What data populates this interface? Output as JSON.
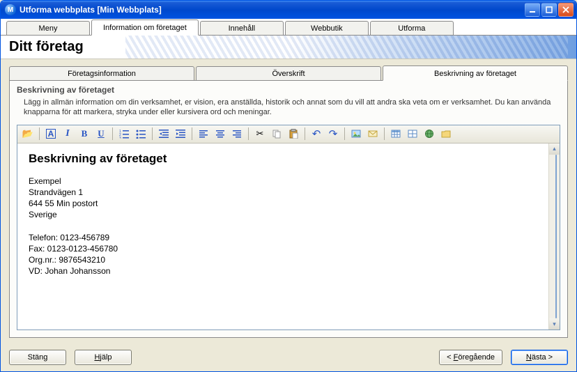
{
  "window": {
    "title": "Utforma webbplats [Min Webbplats]"
  },
  "main_tabs": {
    "items": [
      {
        "label": "Meny"
      },
      {
        "label": "Information om företaget"
      },
      {
        "label": "Innehåll"
      },
      {
        "label": "Webbutik"
      },
      {
        "label": "Utforma"
      }
    ],
    "active_index": 1
  },
  "page_header": "Ditt företag",
  "sub_tabs": {
    "items": [
      {
        "label": "Företagsinformation"
      },
      {
        "label": "Överskrift"
      },
      {
        "label": "Beskrivning av företaget"
      }
    ],
    "active_index": 2
  },
  "panel": {
    "title": "Beskrivning av företaget",
    "description": "Lägg in allmän information om din verksamhet, er vision, era anställda, historik och annat som du vill att andra ska veta om er verksamhet. Du kan använda knapparna för att markera, stryka under eller kursivera ord och meningar."
  },
  "editor": {
    "heading": "Beskrivning av företaget",
    "lines": [
      "Exempel",
      "Strandvägen 1",
      "644 55 Min postort",
      "Sverige",
      "",
      "Telefon: 0123-456789",
      "Fax: 0123-0123-456780",
      "Org.nr.: 9876543210",
      "VD: Johan Johansson"
    ]
  },
  "toolbar_buttons": {
    "open": "📂",
    "font": "A",
    "italic": "I",
    "bold": "B",
    "underline": "U",
    "listnum": "ol-icon",
    "listbul": "ul-icon",
    "outdent": "outdent-icon",
    "indent": "indent-icon",
    "alignl": "align-left-icon",
    "alignc": "align-center-icon",
    "alignr": "align-right-icon",
    "cut": "✂",
    "copy": "copy-icon",
    "paste": "paste-icon",
    "undo": "↶",
    "redo": "↷",
    "image": "image-icon",
    "mail": "mail-icon",
    "table": "table-icon",
    "props": "props-icon",
    "world": "world-icon",
    "meta": "meta-icon"
  },
  "footer": {
    "close": "Stäng",
    "help": "Hjälp",
    "help_ul": "H",
    "prev": "< Föregående",
    "prev_ul": "F",
    "next": "Nästa >",
    "next_ul": "N"
  }
}
